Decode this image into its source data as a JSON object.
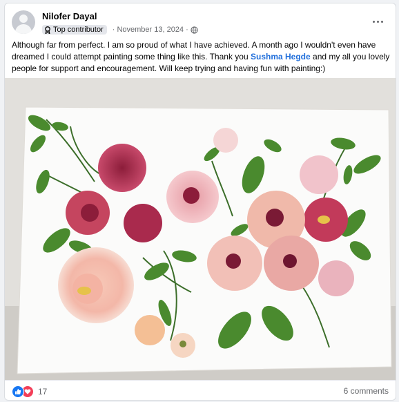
{
  "post": {
    "author": "Nilofer Dayal",
    "badge": "Top contributor",
    "date": "November 13, 2024",
    "dot_separator": "·",
    "text_before_mention": "Although far from perfect. I am so proud of what I have achieved. A month ago I wouldn't even have dreamed I could attempt painting some thing like this. Thank you ",
    "mention": "Sushma Hegde",
    "text_after_mention": " and my all you lovely people for support and encouragement. Will keep trying and having fun with painting:)",
    "image_description_icon": "watercolor-flowers-painting"
  },
  "footer": {
    "reaction_count": "17",
    "comments_label": "6 comments"
  },
  "colors": {
    "accent": "#1877f2",
    "love": "#f33e58",
    "mention": "#216fdb"
  }
}
